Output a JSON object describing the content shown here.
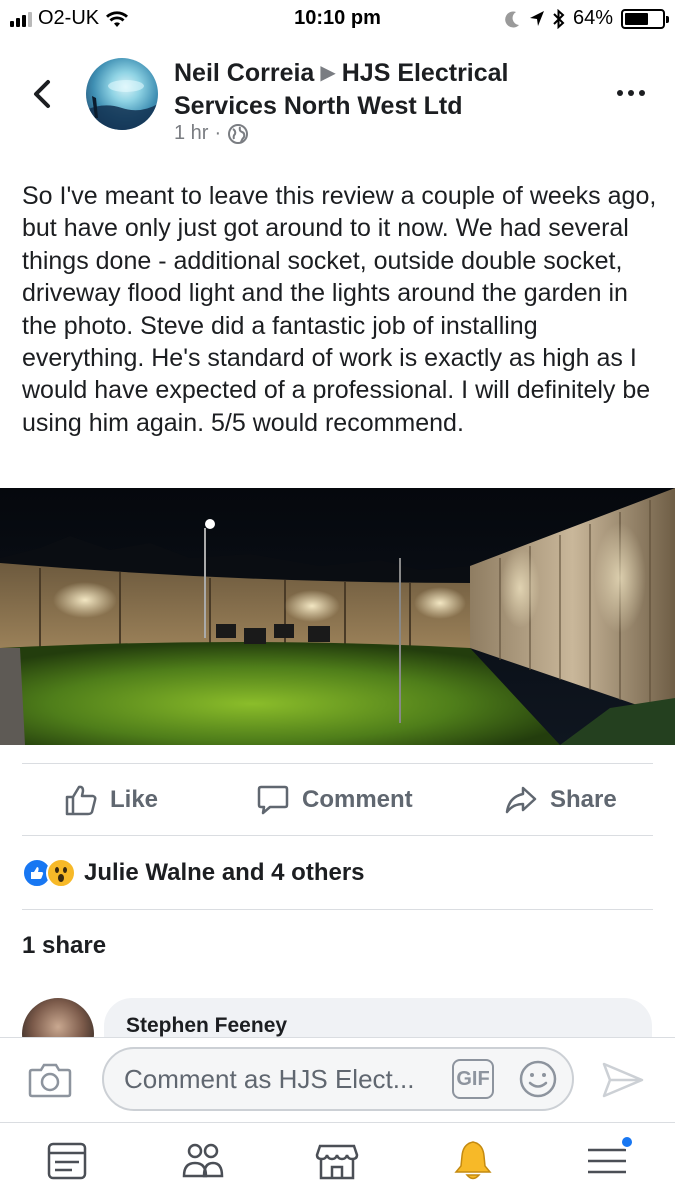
{
  "status_bar": {
    "carrier": "O2-UK",
    "time": "10:10 pm",
    "battery": "64%",
    "battery_level": 0.64
  },
  "post": {
    "author": "Neil Correia",
    "target": "HJS Electrical Services North West Ltd",
    "time": "1 hr",
    "separator": "·",
    "audience_icon": "globe-icon",
    "text": "So I've meant to leave this review a couple of weeks ago, but have only just got around to it now.  We had several things done - additional socket, outside double socket, driveway flood light and the lights around the garden in the photo.  Steve did a fantastic job of installing everything.  He's standard of work is exactly as high as I would have expected of a professional.  I will definitely be using him again. 5/5 would recommend."
  },
  "actions": {
    "like": "Like",
    "comment": "Comment",
    "share": "Share"
  },
  "reactions": {
    "summary": "Julie Walne and 4 others",
    "icons": [
      "like-reaction-icon",
      "wow-reaction-icon"
    ]
  },
  "shares": "1 share",
  "comments": [
    {
      "author": "Stephen Feeney"
    }
  ],
  "composer": {
    "placeholder": "Comment as HJS Elect...",
    "gif_label": "GIF"
  },
  "tab_bar": {
    "tabs": [
      "news-feed-icon",
      "groups-icon",
      "marketplace-icon",
      "notifications-icon",
      "menu-icon"
    ],
    "active": "notifications-icon"
  },
  "colors": {
    "text": "#1c1e21",
    "secondary": "#606770",
    "accent_blue": "#1877f2",
    "active_tab": "#f7b928",
    "divider": "#dadde1"
  }
}
